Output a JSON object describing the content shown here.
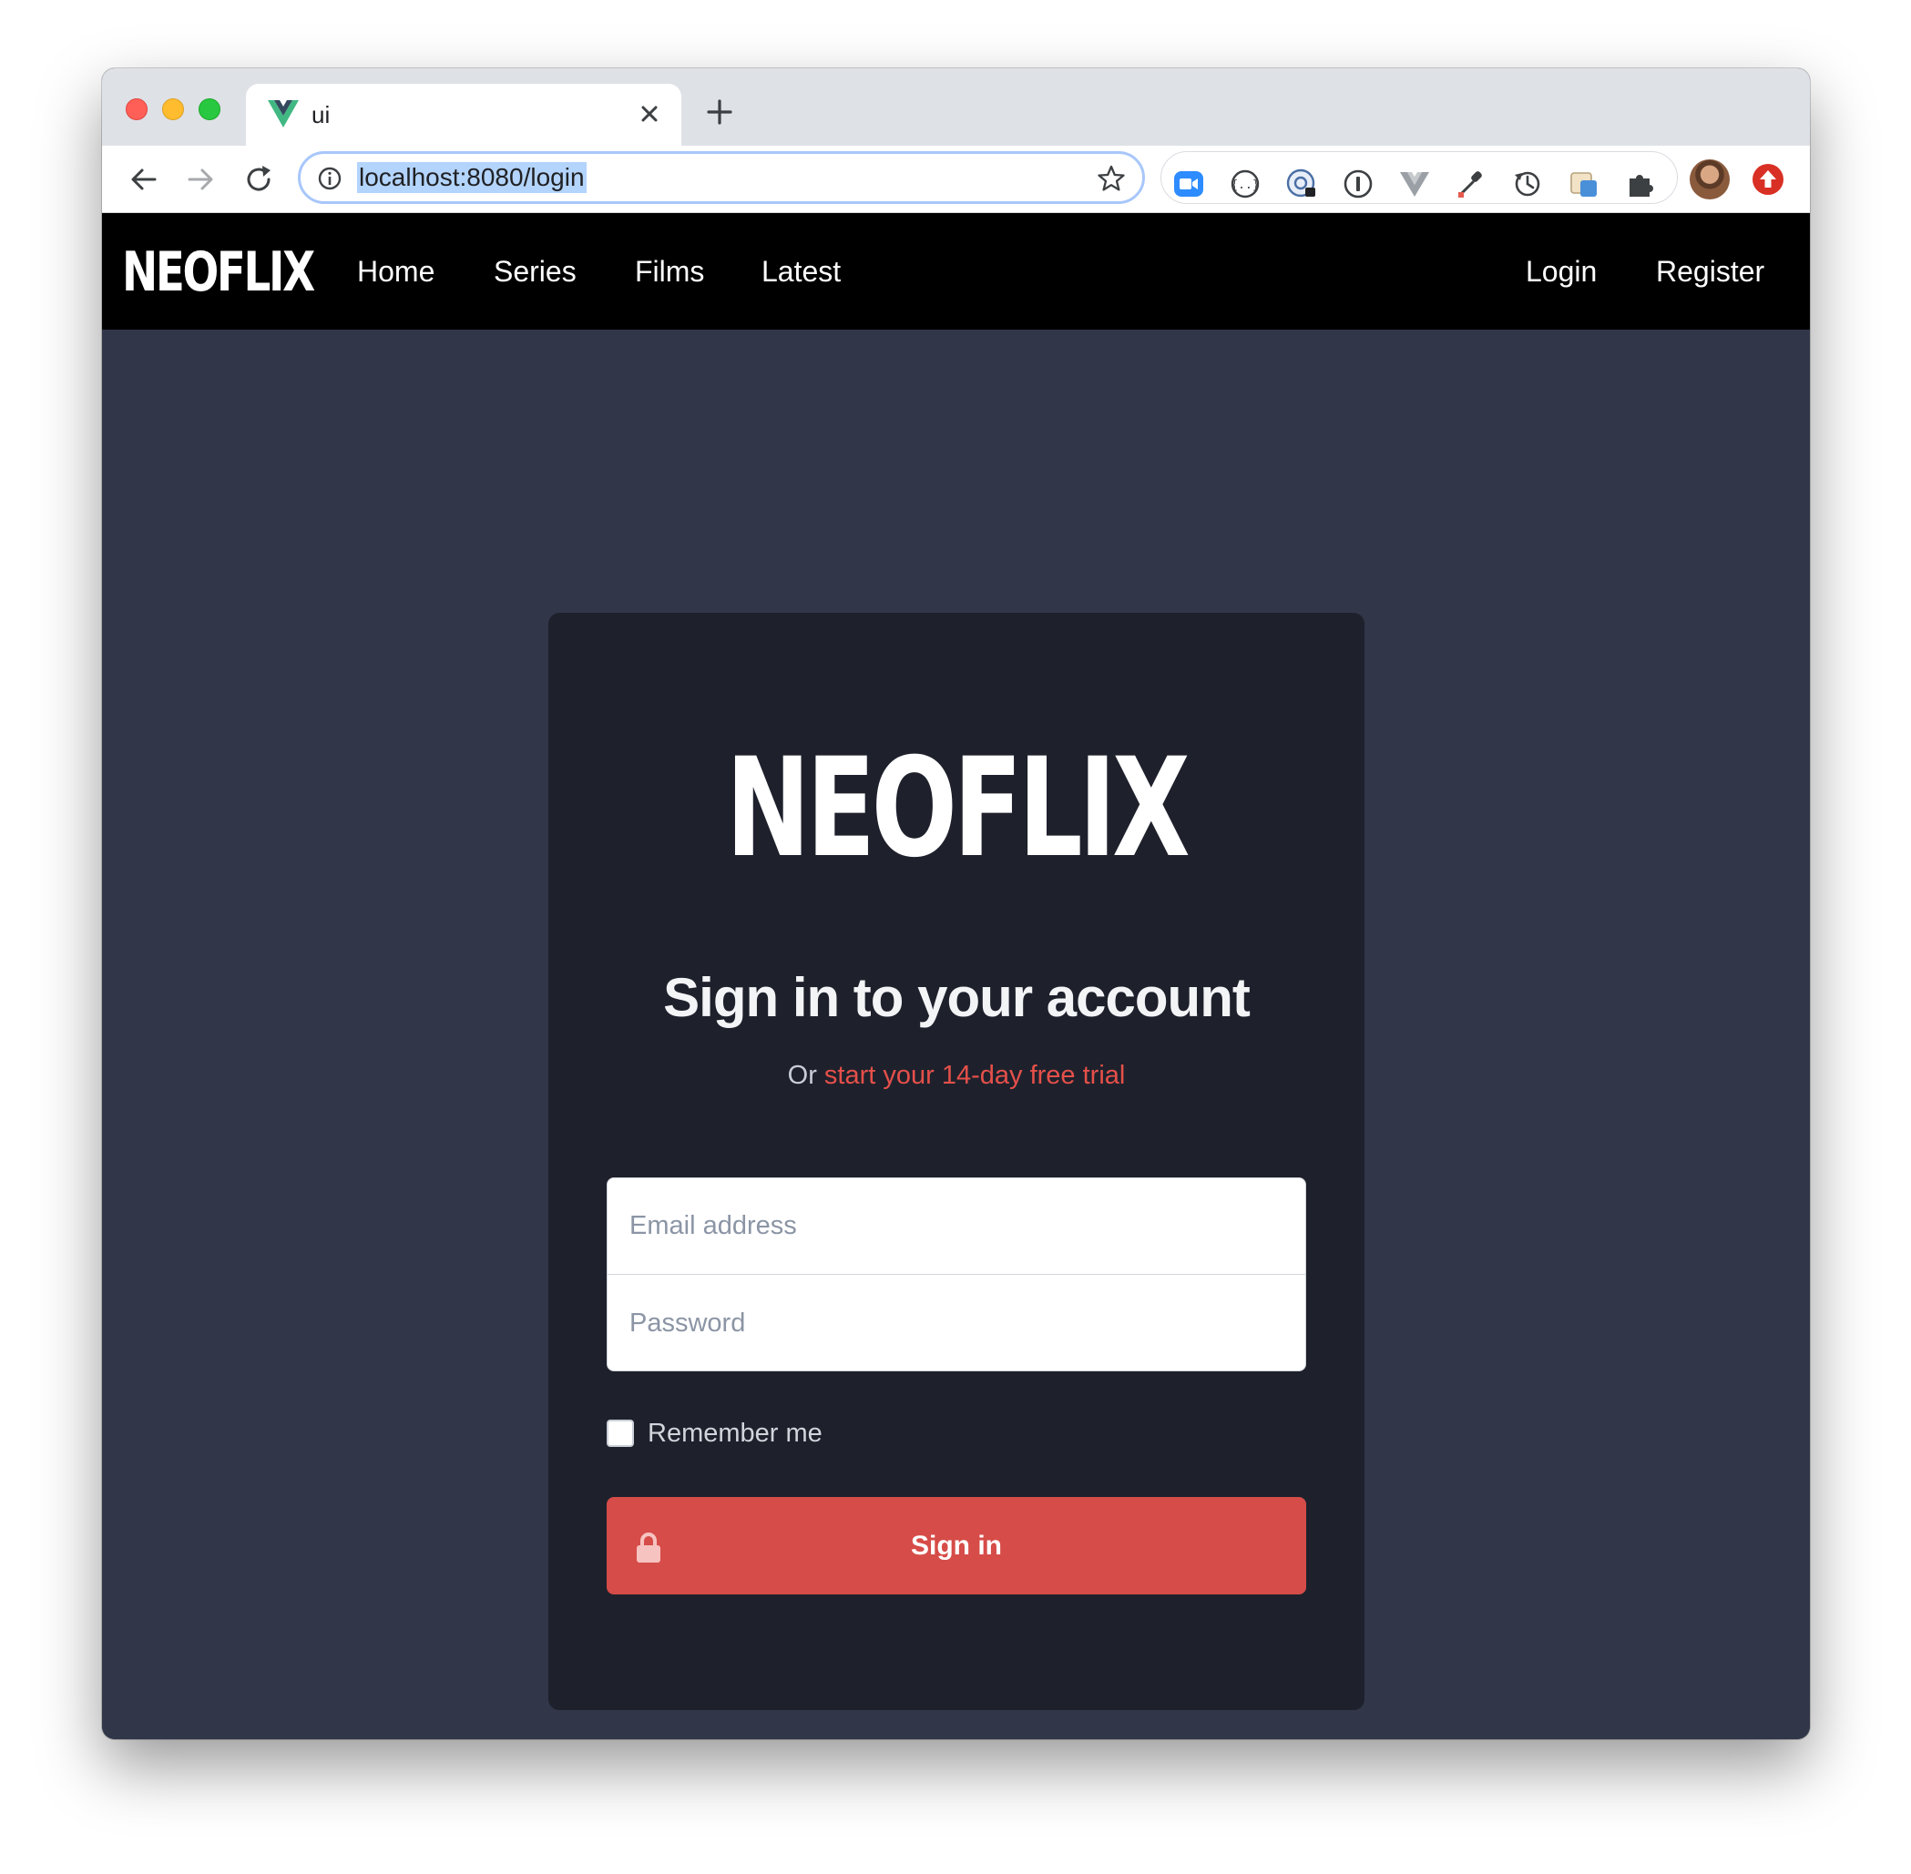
{
  "browser": {
    "tab_title": "ui",
    "url": "localhost:8080/login",
    "extensions": [
      "zoom-icon",
      "json-viewer-icon",
      "password-manager-icon",
      "onepassword-icon",
      "vue-devtools-icon",
      "eyedropper-icon",
      "sync-icon",
      "clipboard-icon",
      "puzzle-icon"
    ]
  },
  "app": {
    "brand": "NEOFLIX",
    "nav": {
      "home": "Home",
      "series": "Series",
      "films": "Films",
      "latest": "Latest",
      "login": "Login",
      "register": "Register"
    },
    "login_card": {
      "logo": "NEOFLIX",
      "heading": "Sign in to your account",
      "sub_prefix": "Or",
      "sub_link": "start your 14-day free trial",
      "email_placeholder": "Email address",
      "password_placeholder": "Password",
      "remember_label": "Remember me",
      "remember_checked": false,
      "submit_label": "Sign in"
    }
  },
  "colors": {
    "accent": "#d64c48",
    "link": "#e5504a",
    "page_bg": "#313649",
    "card_bg": "#1e212c",
    "nav_bg": "#000000"
  }
}
